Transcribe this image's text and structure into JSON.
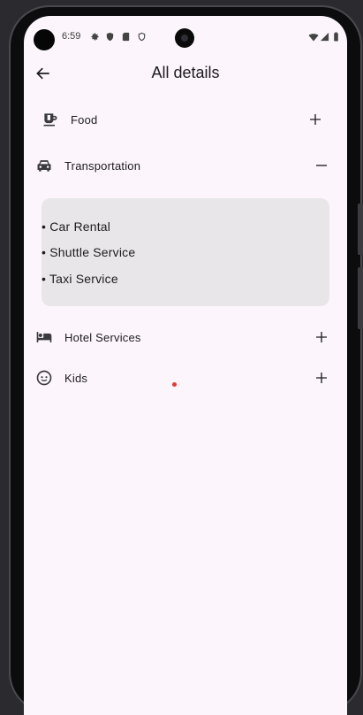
{
  "status_bar": {
    "time": "6:59",
    "icons": [
      "settings-icon",
      "shield-icon",
      "sd-card-icon",
      "shield-outline-icon"
    ],
    "right_icons": [
      "wifi-icon",
      "signal-icon",
      "battery-icon"
    ]
  },
  "app_bar": {
    "back_icon": "arrow-back-icon",
    "title": "All details"
  },
  "categories": [
    {
      "label": "Food",
      "icon": "coffee-icon",
      "expanded": false
    },
    {
      "label": "Transportation",
      "icon": "car-icon",
      "expanded": true,
      "items": [
        "• Car Rental",
        "• Shuttle Service",
        "• Taxi Service"
      ]
    },
    {
      "label": "Hotel Services",
      "icon": "hotel-bed-icon",
      "expanded": false
    },
    {
      "label": "Kids",
      "icon": "child-face-icon",
      "expanded": false
    }
  ],
  "colors": {
    "screen_background": "#fcf6fc",
    "panel_background": "#e8e6e8",
    "text": "#1c1b1f",
    "touch_indicator": "#e53935"
  }
}
